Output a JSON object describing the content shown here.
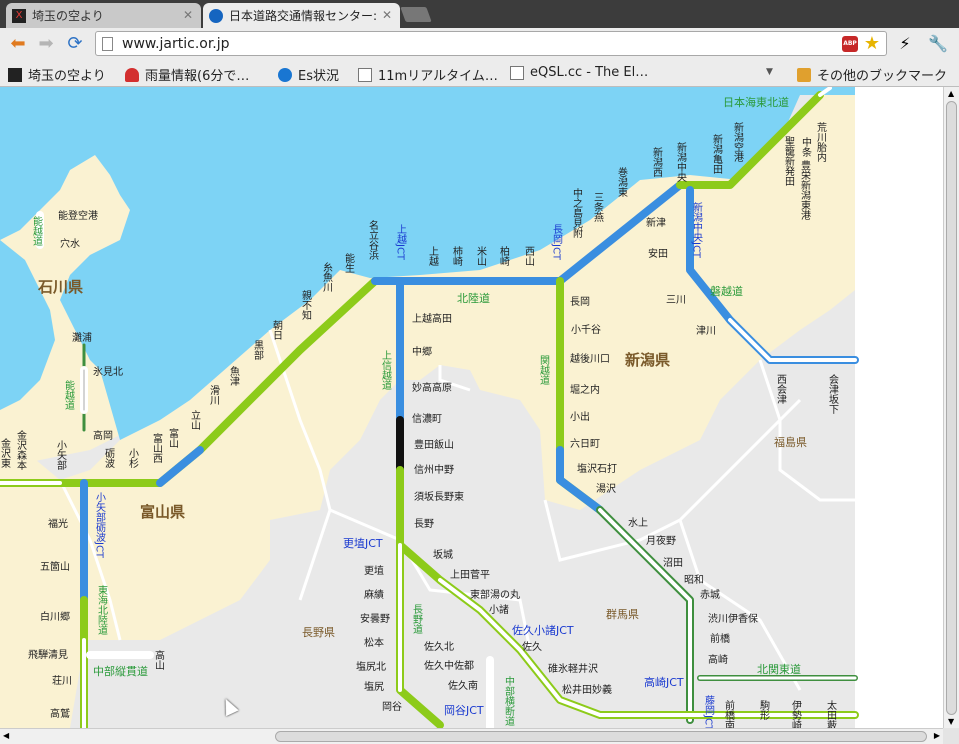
{
  "browser": {
    "tabs": [
      {
        "title": "埼玉の空より",
        "favicon": "x-favicon-icon"
      },
      {
        "title": "日本道路交通情報センター:",
        "favicon": "jartic-favicon-icon"
      }
    ],
    "url": "www.jartic.or.jp",
    "bookmarks": [
      {
        "label": "埼玉の空より"
      },
      {
        "label": "雨量情報(6分で…"
      },
      {
        "label": "Es状況"
      },
      {
        "label": "11mリアルタイム…"
      },
      {
        "label": "eQSL.cc - The El…"
      }
    ],
    "other_bookmarks": "その他のブックマーク",
    "chevron": "▼"
  },
  "map": {
    "prefectures": [
      "石川県",
      "富山県",
      "新潟県",
      "長野県",
      "群馬県",
      "福島県"
    ],
    "sea": "日本海東北道",
    "roads": [
      "北陸道",
      "上信越道",
      "関越道",
      "磐越道",
      "能越道",
      "東海北陸道",
      "中部縦貫道",
      "長野道",
      "上信越道",
      "北関東道",
      "中部横断道"
    ],
    "jcts": [
      "上越JCT",
      "長岡JCT",
      "新潟中央JCT",
      "小矢部砺波JCT",
      "更埴JCT",
      "佐久小諸JCT",
      "高崎JCT",
      "岡谷JCT",
      "藤岡JCT"
    ],
    "places": {
      "noto": [
        "能登空港",
        "穴水"
      ],
      "noetsu": [
        "灘浦",
        "氷見北",
        "高岡"
      ],
      "hokuriku_west": [
        "金沢東",
        "金沢森本",
        "小矢部",
        "砺波",
        "小杉",
        "富山西",
        "富山",
        "立山",
        "滑川",
        "魚津",
        "黒部",
        "朝日",
        "親不知",
        "糸魚川",
        "能生",
        "名立谷浜"
      ],
      "hokuriku_east": [
        "上越",
        "柿崎",
        "米山",
        "柏崎",
        "西山",
        "中之島見附",
        "三条燕",
        "巻潟東",
        "新潟西",
        "新潟中央",
        "新潟亀田",
        "新潟空港",
        "聖籠新発田",
        "豊栄新潟東港",
        "中条",
        "荒川胎内"
      ],
      "banetsu": [
        "新津",
        "安田",
        "三川",
        "津川",
        "西会津",
        "会津坂下"
      ],
      "joshinetsu": [
        "上越高田",
        "中郷",
        "妙高高原",
        "信濃町",
        "豊田飯山",
        "信州中野",
        "須坂長野東",
        "長野",
        "更埴",
        "麻績",
        "安曇野",
        "松本",
        "塩尻北",
        "塩尻",
        "岡谷",
        "坂城",
        "上田菅平",
        "東部湯の丸",
        "小諸",
        "佐久",
        "佐久北",
        "佐久中佐都",
        "佐久南",
        "碓氷軽井沢",
        "松井田妙義"
      ],
      "kanetsu": [
        "長岡",
        "小千谷",
        "越後川口",
        "堀之内",
        "小出",
        "六日町",
        "塩沢石打",
        "湯沢",
        "水上",
        "月夜野",
        "沼田",
        "昭和",
        "赤城",
        "渋川伊香保",
        "前橋",
        "高崎"
      ],
      "tokai": [
        "福光",
        "五箇山",
        "白川郷",
        "飛騨清見",
        "荘川",
        "高鷲",
        "高山"
      ],
      "kitakanto": [
        "前橋南",
        "駒形",
        "伊勢崎",
        "太田藪塚"
      ]
    }
  }
}
